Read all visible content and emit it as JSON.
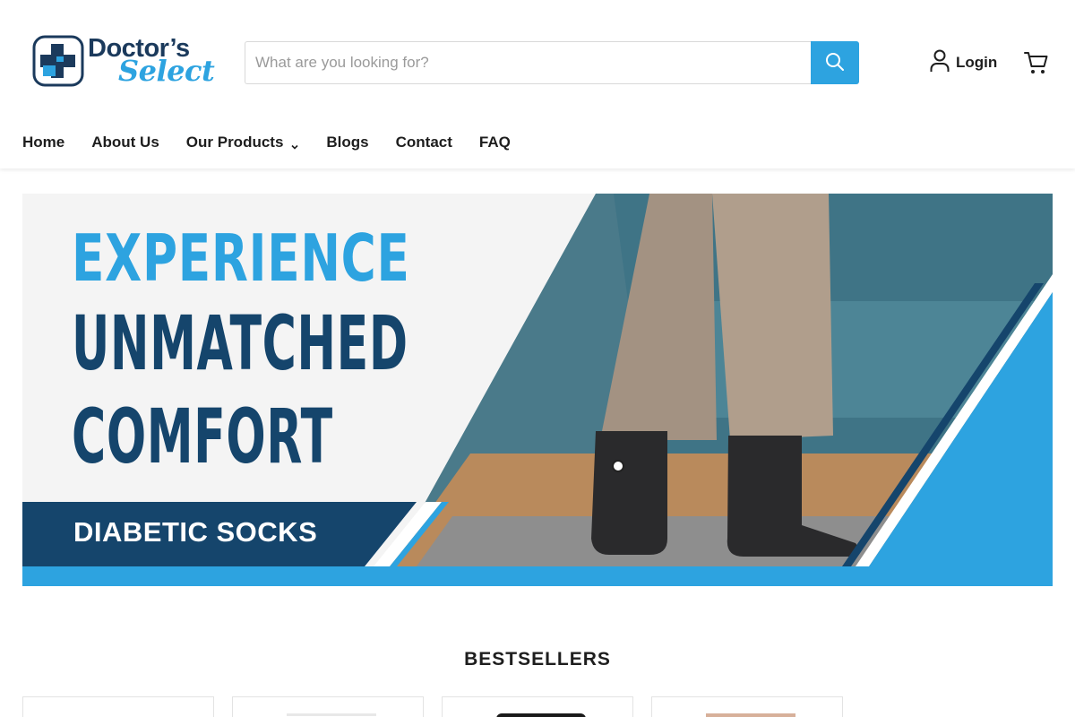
{
  "brand": {
    "name_line1": "Doctor’s",
    "name_line2": "Select",
    "logo_icon": "medical-cross-icon",
    "colors": {
      "navy": "#1b3a5c",
      "blue": "#2da3e0"
    }
  },
  "search": {
    "placeholder": "What are you looking for?",
    "value": "",
    "button_icon": "search-icon"
  },
  "account": {
    "login_label": "Login",
    "login_icon": "user-icon",
    "cart_icon": "cart-icon"
  },
  "nav": {
    "items": [
      {
        "label": "Home"
      },
      {
        "label": "About Us"
      },
      {
        "label": "Our Products",
        "has_dropdown": true
      },
      {
        "label": "Blogs"
      },
      {
        "label": "Contact"
      },
      {
        "label": "FAQ"
      }
    ]
  },
  "hero": {
    "line1": "EXPERIENCE",
    "line2": "UNMATCHED",
    "line3": "COMFORT",
    "tagline": "DIABETIC SOCKS",
    "colors": {
      "accent": "#2da3e0",
      "dark": "#15456c"
    }
  },
  "bestsellers": {
    "title": "BESTSELLERS",
    "products": [
      {},
      {},
      {},
      {}
    ]
  }
}
